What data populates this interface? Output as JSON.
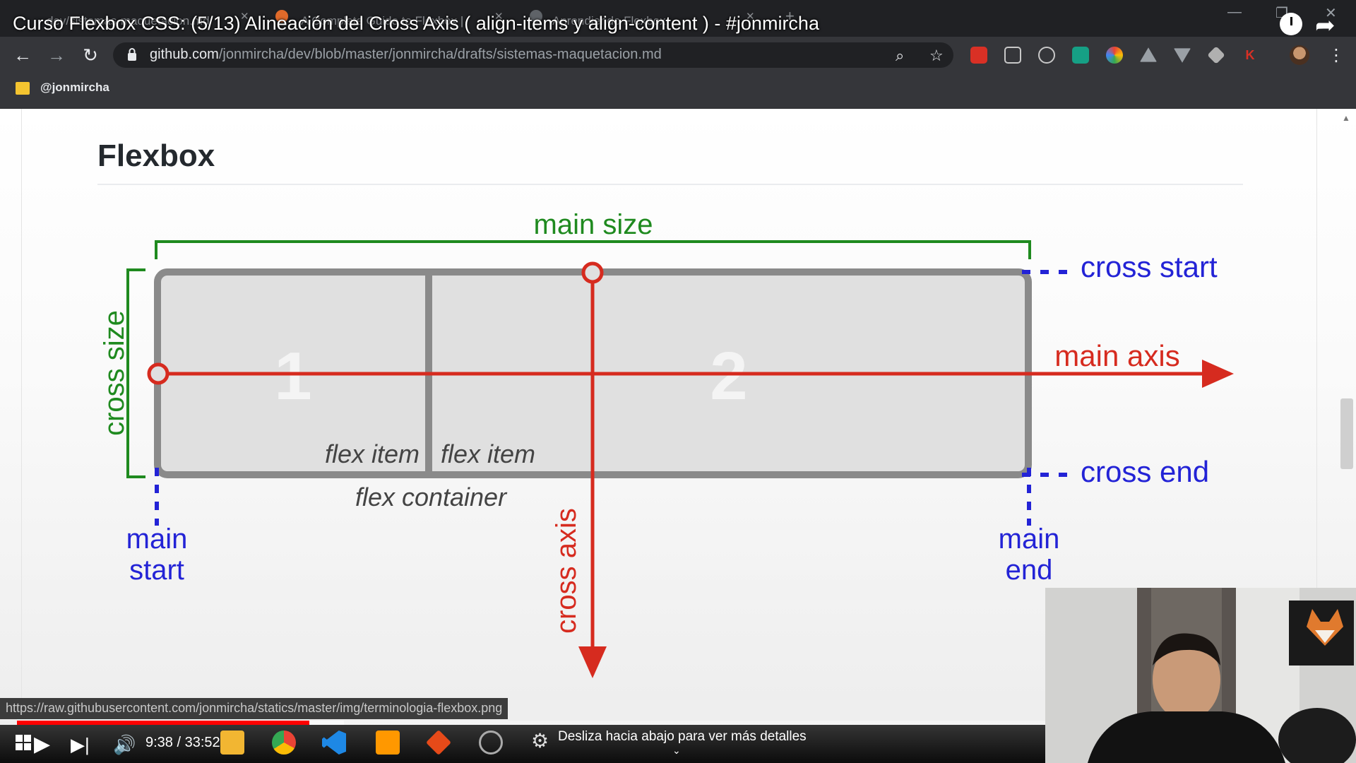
{
  "video": {
    "title": "Curso Flexbox CSS: (5/13) Alineación del Cross Axis ( align-items y align-content ) - #jonmircha",
    "time_current": "9:38",
    "time_total": "33:52",
    "time_display": "9:38 / 33:52",
    "progress_fraction": 0.2845,
    "buffered_fraction": 0.318,
    "notice": "Desliza hacia abajo para ver más detalles"
  },
  "browser": {
    "tabs": [
      {
        "label": "dev/sistemas-maquetacion.md"
      },
      {
        "label": "A Complete Guide to Flexbox |"
      },
      {
        "label": "Aprendiendo Flexbox"
      }
    ],
    "url_host": "github.com",
    "url_path": "/jonmircha/dev/blob/master/jonmircha/drafts/sistemas-maquetacion.md",
    "bookmark": "@jonmircha",
    "status_url": "https://raw.githubusercontent.com/jonmircha/statics/master/img/terminologia-flexbox.png"
  },
  "page": {
    "heading": "Flexbox"
  },
  "diagram": {
    "main_size": "main size",
    "cross_size": "cross size",
    "cross_start": "cross start",
    "cross_end": "cross end",
    "main_axis": "main axis",
    "cross_axis": "cross axis",
    "main_start_1": "main",
    "main_start_2": "start",
    "main_end_1": "main",
    "main_end_2": "end",
    "item1_number": "1",
    "item2_number": "2",
    "item1_label": "flex item",
    "item2_label": "flex item",
    "container_label": "flex container"
  },
  "colors": {
    "green": "#1f8a1f",
    "red": "#d62b1f",
    "blue": "#2323d6",
    "gray": "#8a8a8a",
    "yt_red": "#ff0000"
  }
}
